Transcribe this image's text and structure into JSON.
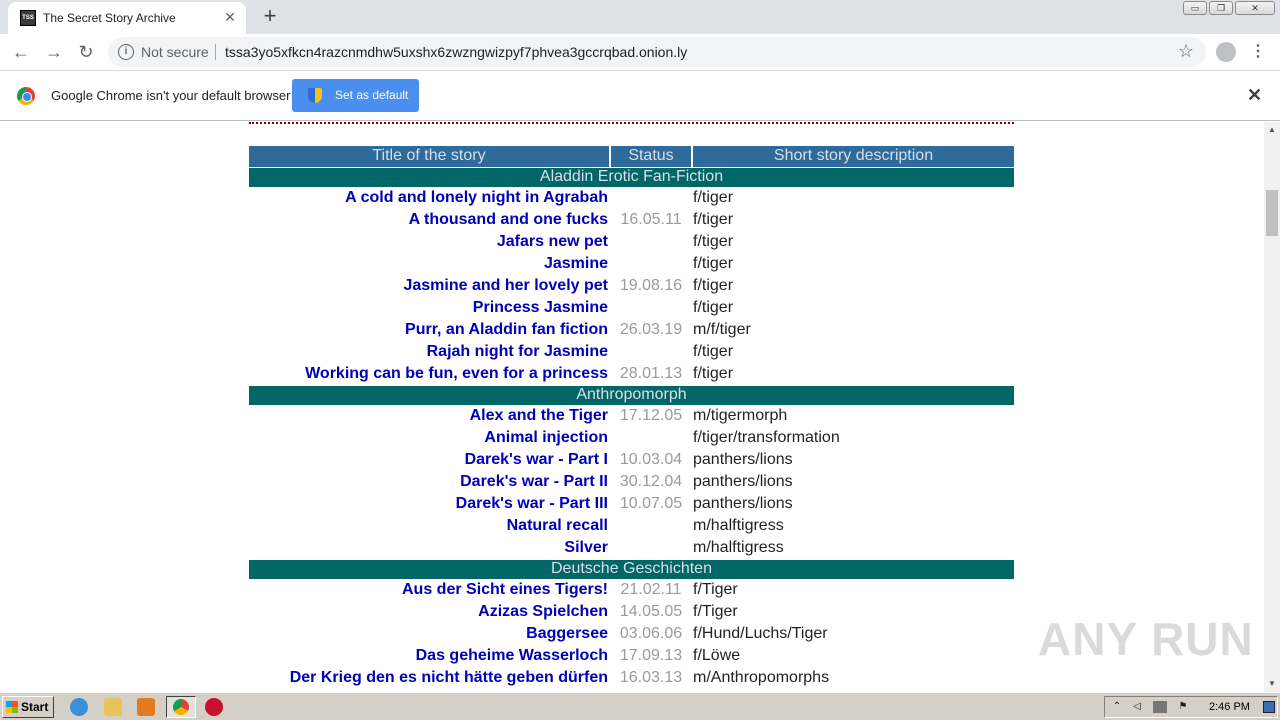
{
  "browser": {
    "tab_title": "The Secret Story Archive",
    "tab_favicon": "TSS",
    "new_tab": "+",
    "not_secure": "Not secure",
    "url": "tssa3yo5xfkcn4razcnmdhw5uxshx6zwzngwizpyf7phvea3gccrqbad.onion.ly",
    "window_controls": [
      "▭",
      "❐",
      "✕"
    ]
  },
  "infobar": {
    "message": "Google Chrome isn't your default browser",
    "button": "Set as default"
  },
  "table": {
    "headers": [
      "Title of the story",
      "Status",
      "Short story description"
    ],
    "sections": [
      {
        "category": "Aladdin Erotic Fan-Fiction",
        "rows": [
          {
            "title": "A cold and lonely night in Agrabah",
            "status": "",
            "desc": "f/tiger"
          },
          {
            "title": "A thousand and one fucks",
            "status": "16.05.11",
            "desc": "f/tiger"
          },
          {
            "title": "Jafars new pet",
            "status": "",
            "desc": "f/tiger"
          },
          {
            "title": "Jasmine",
            "status": "",
            "desc": "f/tiger"
          },
          {
            "title": "Jasmine and her lovely pet",
            "status": "19.08.16",
            "desc": "f/tiger"
          },
          {
            "title": "Princess Jasmine",
            "status": "",
            "desc": "f/tiger"
          },
          {
            "title": "Purr, an Aladdin fan fiction",
            "status": "26.03.19",
            "desc": "m/f/tiger"
          },
          {
            "title": "Rajah night for Jasmine",
            "status": "",
            "desc": "f/tiger"
          },
          {
            "title": "Working can be fun, even for a princess",
            "status": "28.01.13",
            "desc": "f/tiger"
          }
        ]
      },
      {
        "category": "Anthropomorph",
        "rows": [
          {
            "title": "Alex and the Tiger",
            "status": "17.12.05",
            "desc": "m/tigermorph"
          },
          {
            "title": "Animal injection",
            "status": "",
            "desc": "f/tiger/transformation"
          },
          {
            "title": "Darek's war - Part I",
            "status": "10.03.04",
            "desc": "panthers/lions"
          },
          {
            "title": "Darek's war - Part II",
            "status": "30.12.04",
            "desc": "panthers/lions"
          },
          {
            "title": "Darek's war - Part III",
            "status": "10.07.05",
            "desc": "panthers/lions"
          },
          {
            "title": "Natural recall",
            "status": "",
            "desc": "m/halftigress"
          },
          {
            "title": "Silver",
            "status": "",
            "desc": "m/halftigress"
          }
        ]
      },
      {
        "category": "Deutsche Geschichten",
        "rows": [
          {
            "title": "Aus der Sicht eines Tigers!",
            "status": "21.02.11",
            "desc": "f/Tiger"
          },
          {
            "title": "Azizas Spielchen",
            "status": "14.05.05",
            "desc": "f/Tiger"
          },
          {
            "title": "Baggersee",
            "status": "03.06.06",
            "desc": "f/Hund/Luchs/Tiger"
          },
          {
            "title": "Das geheime Wasserloch",
            "status": "17.09.13",
            "desc": "f/Löwe"
          },
          {
            "title": "Der Krieg den es nicht hätte geben dürfen",
            "status": "16.03.13",
            "desc": "m/Anthropomorphs"
          }
        ]
      }
    ]
  },
  "watermark": "ANY RUN",
  "taskbar": {
    "start": "Start",
    "clock": "2:46 PM"
  },
  "icons": {
    "back": "back-arrow-icon",
    "forward": "forward-arrow-icon",
    "reload": "reload-icon",
    "info": "info-icon",
    "star": "star-icon",
    "profile": "profile-icon",
    "menu": "menu-dots-icon"
  }
}
